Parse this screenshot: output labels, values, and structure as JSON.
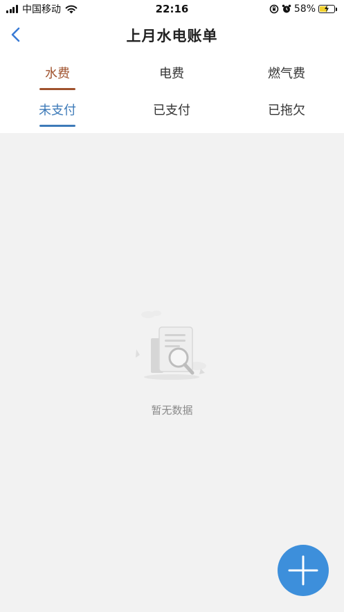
{
  "status_bar": {
    "carrier": "中国移动",
    "time": "22:16",
    "battery_percent": "58%",
    "battery_level": 0.58
  },
  "nav": {
    "title": "上月水电账单",
    "back_icon": "chevron-left-icon"
  },
  "category_tabs": [
    {
      "label": "水费",
      "active": true
    },
    {
      "label": "电费",
      "active": false
    },
    {
      "label": "燃气费",
      "active": false
    }
  ],
  "status_tabs": [
    {
      "label": "未支付",
      "active": true
    },
    {
      "label": "已支付",
      "active": false
    },
    {
      "label": "已拖欠",
      "active": false
    }
  ],
  "empty_state": {
    "message": "暂无数据",
    "icon": "document-search-icon"
  },
  "fab": {
    "icon": "plus-icon"
  },
  "colors": {
    "category_active": "#a0522d",
    "status_active": "#3d7ab8",
    "accent": "#3d8fdb",
    "back_icon": "#3a7bd5",
    "background": "#f2f2f2"
  }
}
